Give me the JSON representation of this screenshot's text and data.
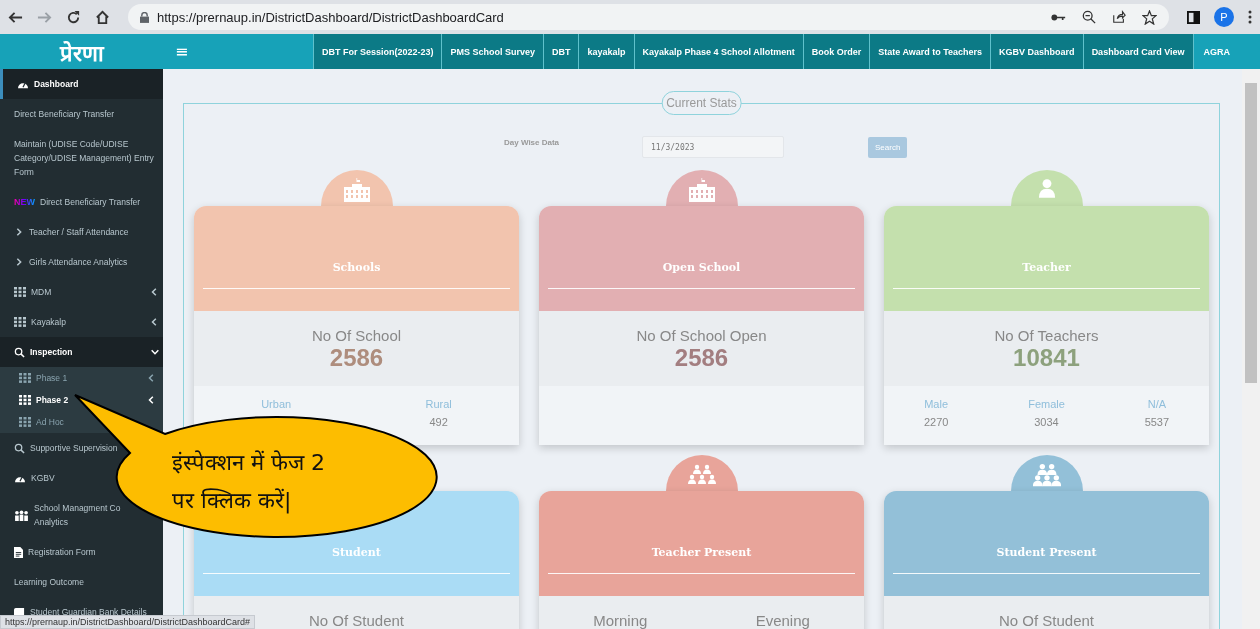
{
  "browser": {
    "url": "https://prernaup.in/DistrictDashboard/DistrictDashboardCard",
    "forward_disabled": true,
    "profile": "P",
    "status_url": "https://prernaup.in/DistrictDashboard/DistrictDashboardCard#"
  },
  "logo": "प्रेरणा",
  "menu_toggle": "≡",
  "top_links": [
    {
      "label": "DBT For Session(2022-23)",
      "selected": false
    },
    {
      "label": "PMS School Survey",
      "selected": false
    },
    {
      "label": "DBT",
      "selected": false
    },
    {
      "label": "kayakalp",
      "selected": false
    },
    {
      "label": "Kayakalp Phase 4 School Allotment",
      "selected": false
    },
    {
      "label": "Book Order",
      "selected": false
    },
    {
      "label": "State Award to Teachers",
      "selected": false
    },
    {
      "label": "KGBV Dashboard",
      "selected": false
    },
    {
      "label": "Dashboard Card View",
      "selected": false
    },
    {
      "label": "AGRA",
      "selected": true
    }
  ],
  "sidebar": {
    "items": [
      {
        "kind": "gauge",
        "label": "Dashboard",
        "selected": true
      },
      {
        "kind": "plain",
        "label": "Direct Beneficiary Transfer",
        "selected": false
      },
      {
        "kind": "plain",
        "label": "Maintain (UDISE Code/UDISE Category/UDISE Management) Entry Form",
        "selected": false
      },
      {
        "kind": "new",
        "badge": "NEW",
        "label": "Direct Beneficiary Transfer",
        "selected": false
      },
      {
        "kind": "arrow",
        "label": "Teacher / Staff Attendance",
        "selected": false
      },
      {
        "kind": "arrow",
        "label": "Girls Attendance Analytics",
        "selected": false
      },
      {
        "kind": "grid",
        "label": "MDM",
        "selected": false,
        "expandable": true
      },
      {
        "kind": "grid",
        "label": "Kayakalp",
        "selected": false,
        "expandable": true
      },
      {
        "kind": "search",
        "label": "Inspection",
        "selected": false,
        "expandable": true,
        "expanded": true,
        "children": [
          {
            "kind": "grid",
            "label": "Phase 1",
            "selected": false,
            "expandable": true
          },
          {
            "kind": "grid",
            "label": "Phase 2",
            "selected": true,
            "expandable": true
          },
          {
            "kind": "grid",
            "label": "Ad Hoc",
            "selected": false
          }
        ]
      },
      {
        "kind": "search",
        "label": "Supportive Supervision",
        "selected": false
      },
      {
        "kind": "gauge",
        "label": "KGBV",
        "selected": false
      },
      {
        "kind": "people",
        "label": "School Managment Co\nAnalytics",
        "selected": false
      },
      {
        "kind": "form",
        "label": "Registration Form",
        "selected": false
      },
      {
        "kind": "plain",
        "label": "Learning Outcome",
        "selected": false
      },
      {
        "kind": "book",
        "label": "Student Guardian Bank Details",
        "selected": false
      }
    ]
  },
  "stats": {
    "legend": "Current Stats",
    "filter_label": "Day Wise Data",
    "date": "11/3/2023",
    "search_button": "Search"
  },
  "cards": [
    {
      "title": "Schools",
      "kind": "building",
      "color": "#f2c4ae",
      "stats": [
        {
          "label": "No Of School",
          "value": "2586"
        }
      ],
      "footer": [
        {
          "label": "Urban"
        },
        {
          "label": "Rural",
          "value": "492"
        }
      ]
    },
    {
      "title": "Open School",
      "kind": "building",
      "color": "#e2afb2",
      "stats": [
        {
          "label": "No Of School Open",
          "value": "2586"
        }
      ]
    },
    {
      "title": "Teacher",
      "kind": "person",
      "color": "#c4e0ad",
      "stats": [
        {
          "label": "No Of Teachers",
          "value": "10841"
        }
      ],
      "footer": [
        {
          "label": "Male",
          "value": "2270"
        },
        {
          "label": "Female",
          "value": "3034"
        },
        {
          "label": "N/A",
          "value": "5537"
        }
      ]
    },
    {
      "title": "Student",
      "kind": "group",
      "color": "#aadcf5",
      "stats": [
        {
          "label": "No Of Student"
        }
      ]
    },
    {
      "title": "Teacher Present",
      "kind": "group",
      "color": "#e8a49a",
      "stats": [
        {
          "label": "Morning"
        },
        {
          "label": "Evening"
        }
      ]
    },
    {
      "title": "Student Present",
      "kind": "crowd",
      "color": "#93c0d8",
      "stats": [
        {
          "label": "No Of Student"
        }
      ]
    }
  ],
  "callout": {
    "lines": [
      "इंस्पेक्शन में फेज 2",
      "पर क्लिक करें|"
    ]
  }
}
